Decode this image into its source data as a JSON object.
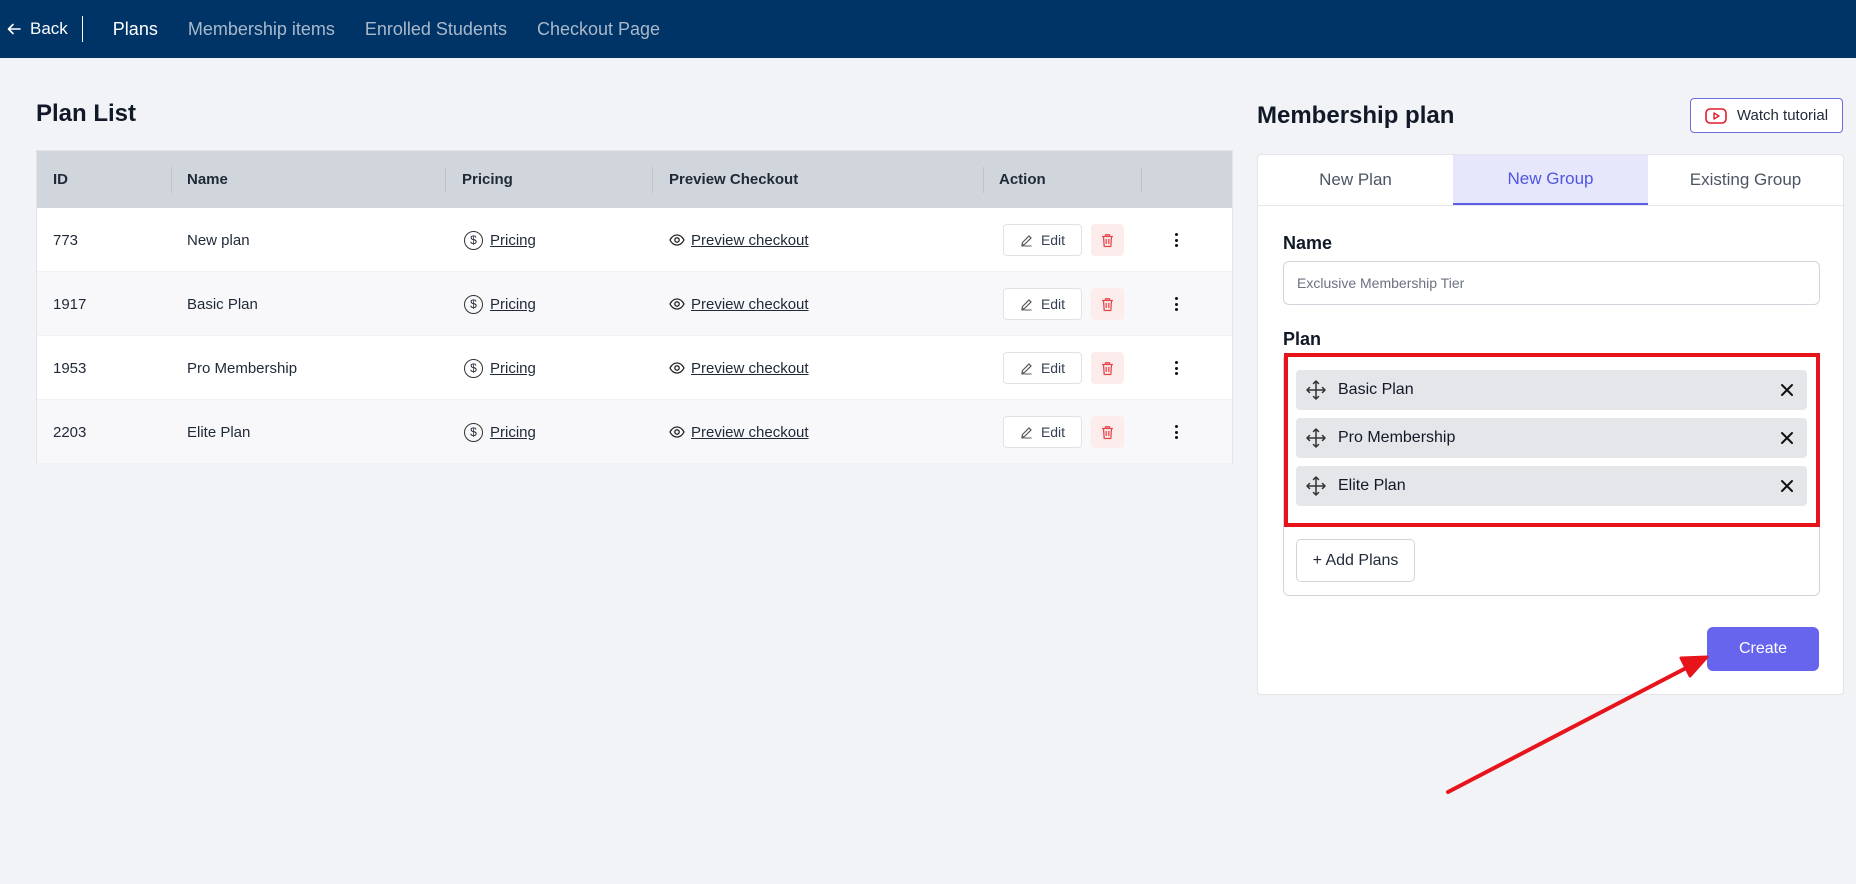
{
  "nav": {
    "back_label": "Back",
    "tabs": [
      "Plans",
      "Membership items",
      "Enrolled Students",
      "Checkout Page"
    ],
    "active_tab": "Plans"
  },
  "plan_list": {
    "title": "Plan List",
    "columns": [
      "ID",
      "Name",
      "Pricing",
      "Preview Checkout",
      "Action"
    ],
    "rows": [
      {
        "id": "773",
        "name": "New plan",
        "pricing": "Pricing",
        "preview": "Preview checkout",
        "edit": "Edit"
      },
      {
        "id": "1917",
        "name": "Basic Plan",
        "pricing": "Pricing",
        "preview": "Preview checkout",
        "edit": "Edit"
      },
      {
        "id": "1953",
        "name": "Pro Membership",
        "pricing": "Pricing",
        "preview": "Preview checkout",
        "edit": "Edit"
      },
      {
        "id": "2203",
        "name": "Elite Plan",
        "pricing": "Pricing",
        "preview": "Preview checkout",
        "edit": "Edit"
      }
    ]
  },
  "membership_plan": {
    "title": "Membership plan",
    "watch_tutorial": "Watch tutorial",
    "tabs": [
      "New Plan",
      "New Group",
      "Existing Group"
    ],
    "active_tab": "New Group",
    "name_label": "Name",
    "name_value": "Exclusive Membership Tier",
    "plan_label": "Plan",
    "plans": [
      "Basic Plan",
      "Pro Membership",
      "Elite Plan"
    ],
    "add_plans": "+ Add Plans",
    "create": "Create"
  },
  "colors": {
    "topbar": "#003366",
    "accent": "#6764ee",
    "highlight": "#e8141b",
    "trash": "#e5484d"
  },
  "icons": [
    "arrow-left-icon",
    "dollar-circle-icon",
    "eye-icon",
    "pencil-icon",
    "trash-icon",
    "more-vertical-icon",
    "youtube-icon",
    "move-icon",
    "close-icon"
  ]
}
